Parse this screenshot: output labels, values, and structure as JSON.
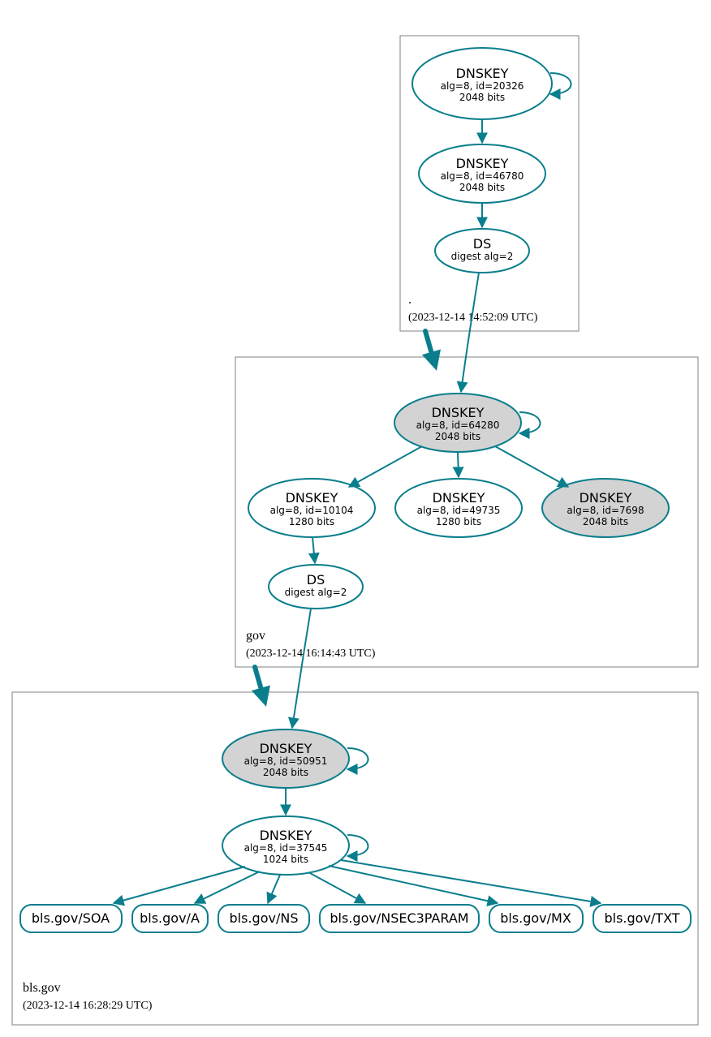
{
  "colors": {
    "edge": "#0A7E8C",
    "shaded": "#d3d3d3"
  },
  "zones": {
    "root": {
      "label": ".",
      "timestamp": "(2023-12-14 14:52:09 UTC)"
    },
    "gov": {
      "label": "gov",
      "timestamp": "(2023-12-14 16:14:43 UTC)"
    },
    "bls": {
      "label": "bls.gov",
      "timestamp": "(2023-12-14 16:28:29 UTC)"
    }
  },
  "nodes": {
    "root_ksk": {
      "title": "DNSKEY",
      "line2": "alg=8, id=20326",
      "line3": "2048 bits"
    },
    "root_zsk": {
      "title": "DNSKEY",
      "line2": "alg=8, id=46780",
      "line3": "2048 bits"
    },
    "root_ds": {
      "title": "DS",
      "line2": "digest alg=2"
    },
    "gov_ksk": {
      "title": "DNSKEY",
      "line2": "alg=8, id=64280",
      "line3": "2048 bits"
    },
    "gov_zsk1": {
      "title": "DNSKEY",
      "line2": "alg=8, id=10104",
      "line3": "1280 bits"
    },
    "gov_zsk2": {
      "title": "DNSKEY",
      "line2": "alg=8, id=49735",
      "line3": "1280 bits"
    },
    "gov_ksk2": {
      "title": "DNSKEY",
      "line2": "alg=8, id=7698",
      "line3": "2048 bits"
    },
    "gov_ds": {
      "title": "DS",
      "line2": "digest alg=2"
    },
    "bls_ksk": {
      "title": "DNSKEY",
      "line2": "alg=8, id=50951",
      "line3": "2048 bits"
    },
    "bls_zsk": {
      "title": "DNSKEY",
      "line2": "alg=8, id=37545",
      "line3": "1024 bits"
    }
  },
  "rrsets": {
    "soa": "bls.gov/SOA",
    "a": "bls.gov/A",
    "ns": "bls.gov/NS",
    "nsec": "bls.gov/NSEC3PARAM",
    "mx": "bls.gov/MX",
    "txt": "bls.gov/TXT"
  }
}
